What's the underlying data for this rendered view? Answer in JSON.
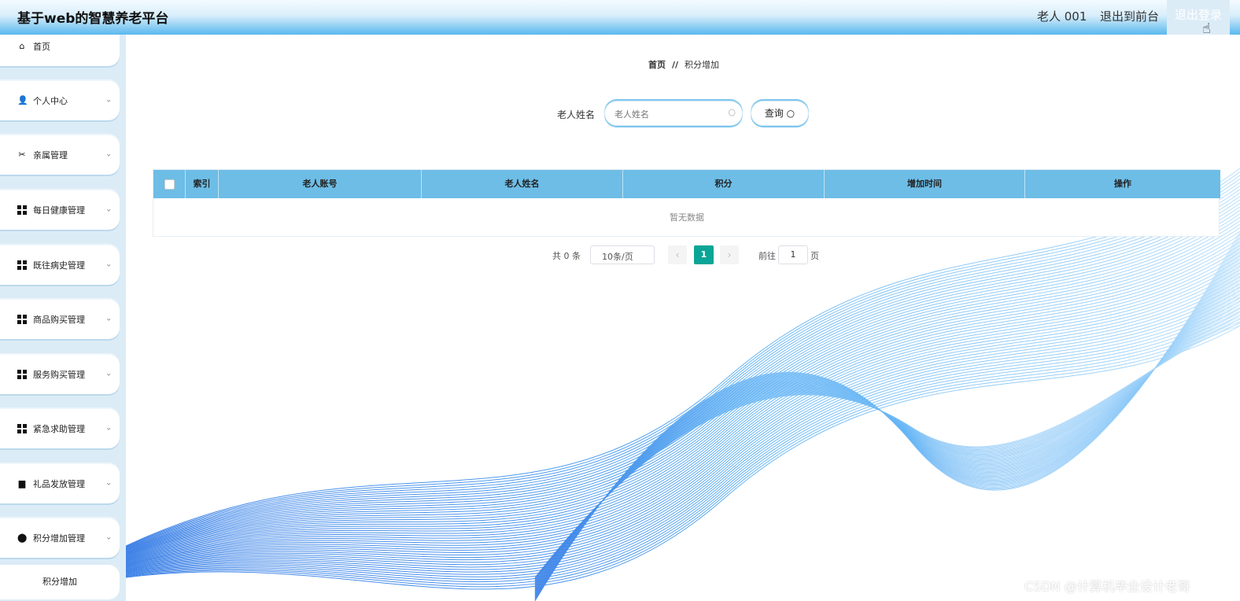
{
  "header": {
    "title": "基于web的智慧养老平台",
    "user": "老人 001",
    "front": "退出到前台",
    "logout": "退出登录"
  },
  "sidebar": {
    "items": [
      {
        "label": "首页",
        "icon": "home-icon"
      },
      {
        "label": "个人中心",
        "icon": "user-icon"
      },
      {
        "label": "亲属管理",
        "icon": "family-icon"
      },
      {
        "label": "每日健康管理",
        "icon": "grid-icon"
      },
      {
        "label": "既往病史管理",
        "icon": "grid-icon"
      },
      {
        "label": "商品购买管理",
        "icon": "grid-icon"
      },
      {
        "label": "服务购买管理",
        "icon": "grid-icon"
      },
      {
        "label": "紧急求助管理",
        "icon": "grid-icon"
      },
      {
        "label": "礼品发放管理",
        "icon": "gift-icon"
      },
      {
        "label": "积分增加管理",
        "icon": "location-icon"
      }
    ],
    "sub_item": "积分增加"
  },
  "breadcrumb": {
    "home": "首页",
    "sep": "//",
    "current": "积分增加"
  },
  "search": {
    "label": "老人姓名",
    "placeholder": "老人姓名",
    "button": "查询"
  },
  "table": {
    "columns": [
      "索引",
      "老人账号",
      "老人姓名",
      "积分",
      "增加时间",
      "操作"
    ],
    "empty": "暂无数据"
  },
  "pagination": {
    "total": "共 0 条",
    "page_size": "10条/页",
    "current": "1",
    "goto_prefix": "前往",
    "goto_value": "1",
    "goto_suffix": "页"
  },
  "watermark": "CSDN @计算机毕业设计老哥",
  "colors": {
    "accent": "#0aa596",
    "header_blue": "#59b8ee",
    "table_head": "#6dbde6"
  }
}
